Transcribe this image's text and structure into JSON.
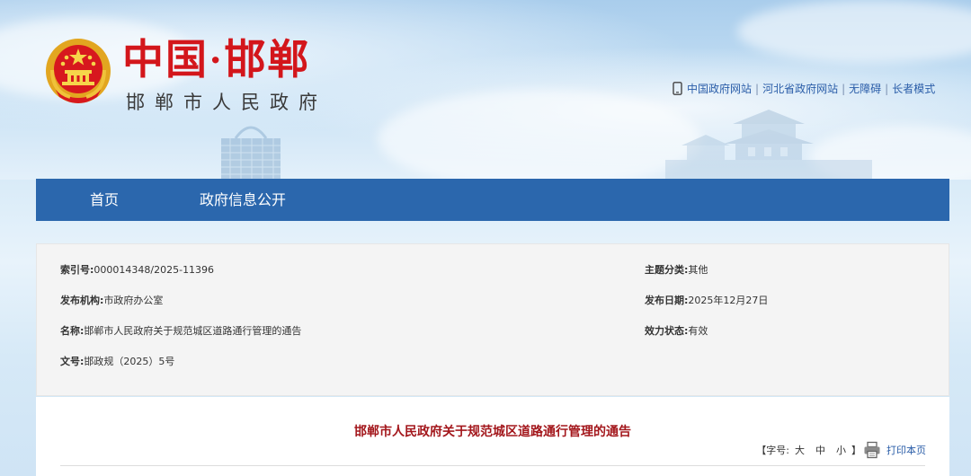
{
  "header": {
    "logo_title": "中国·邯郸",
    "logo_subtitle": "邯郸市人民政府",
    "emblem_icon": "national-emblem-icon",
    "links": [
      "中国政府网站",
      "河北省政府网站",
      "无障碍",
      "长者模式"
    ],
    "phone_icon": "mobile-phone-icon"
  },
  "nav": {
    "items": [
      "首页",
      "政府信息公开"
    ]
  },
  "meta": {
    "index_label": "索引号:",
    "index_value": "000014348/2025-11396",
    "category_label": "主题分类:",
    "category_value": "其他",
    "org_label": "发布机构:",
    "org_value": "市政府办公室",
    "date_label": "发布日期:",
    "date_value": "2025年12月27日",
    "name_label": "名称:",
    "name_value": "邯郸市人民政府关于规范城区道路通行管理的通告",
    "status_label": "效力状态:",
    "status_value": "有效",
    "docno_label": "文号:",
    "docno_value": "邯政规（2025）5号"
  },
  "article": {
    "title": "邯郸市人民政府关于规范城区道路通行管理的通告",
    "font_label": "【字号:",
    "size_large": "大",
    "size_medium": "中",
    "size_small": "小",
    "font_close": "】",
    "print_label": "打印本页",
    "print_icon": "printer-icon"
  },
  "colors": {
    "nav_bg": "#2b67ad",
    "logo_red": "#d3161b",
    "title_red": "#a3171c",
    "link_blue": "#2a5da8"
  }
}
